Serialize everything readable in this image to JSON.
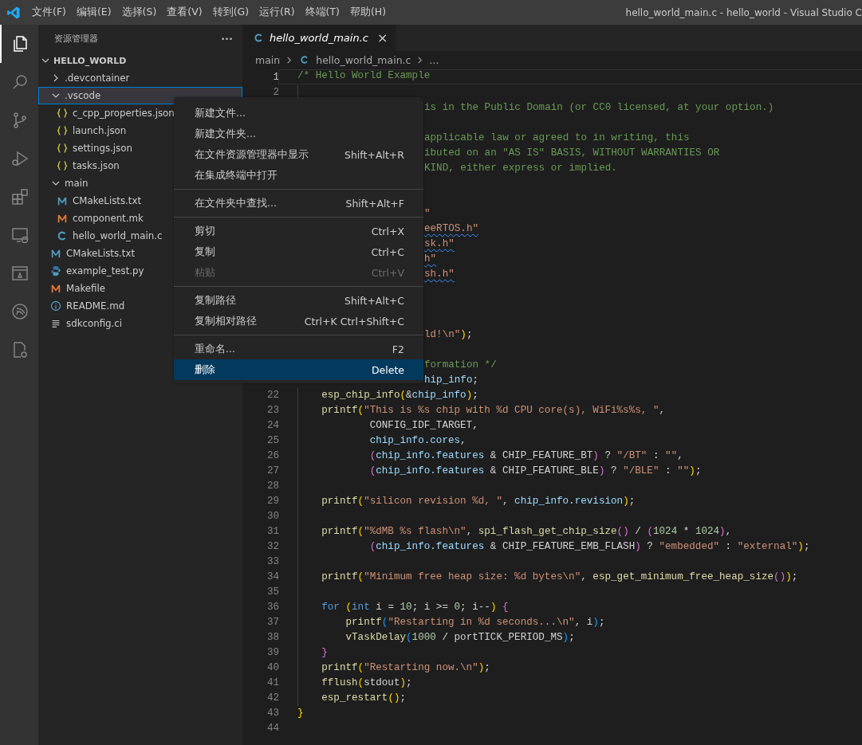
{
  "title_bar": {
    "menus": [
      "文件(F)",
      "编辑(E)",
      "选择(S)",
      "查看(V)",
      "转到(G)",
      "运行(R)",
      "终端(T)",
      "帮助(H)"
    ],
    "title": "hello_world_main.c - hello_world - Visual Studio C"
  },
  "activity_bar": [
    {
      "kind": "files",
      "selected": true
    },
    {
      "kind": "search",
      "selected": false
    },
    {
      "kind": "branch",
      "selected": false
    },
    {
      "kind": "debug",
      "selected": false
    },
    {
      "kind": "extensions",
      "selected": false
    },
    {
      "kind": "remote",
      "selected": false
    },
    {
      "kind": "panel",
      "selected": false
    },
    {
      "kind": "signal",
      "selected": false
    },
    {
      "kind": "doc-gear",
      "selected": false
    }
  ],
  "sidebar": {
    "title": "资源管理器",
    "more": "···",
    "root": {
      "label": "HELLO_WORLD",
      "expanded": true,
      "children": [
        {
          "label": ".devcontainer",
          "kind": "folder",
          "expanded": false,
          "selected": false
        },
        {
          "label": ".vscode",
          "kind": "folder",
          "expanded": true,
          "selected": true,
          "children": [
            {
              "label": "c_cpp_properties.json",
              "kind": "json",
              "selected": false
            },
            {
              "label": "launch.json",
              "kind": "json",
              "selected": false
            },
            {
              "label": "settings.json",
              "kind": "json",
              "selected": false
            },
            {
              "label": "tasks.json",
              "kind": "json",
              "selected": false
            }
          ]
        },
        {
          "label": "main",
          "kind": "folder",
          "expanded": true,
          "selected": false,
          "children": [
            {
              "label": "CMakeLists.txt",
              "kind": "cmake",
              "selected": false
            },
            {
              "label": "component.mk",
              "kind": "make",
              "selected": false
            },
            {
              "label": "hello_world_main.c",
              "kind": "c",
              "selected": false
            }
          ]
        },
        {
          "label": "CMakeLists.txt",
          "kind": "cmake",
          "selected": false
        },
        {
          "label": "example_test.py",
          "kind": "python",
          "selected": false
        },
        {
          "label": "Makefile",
          "kind": "make",
          "selected": false
        },
        {
          "label": "README.md",
          "kind": "info",
          "selected": false
        },
        {
          "label": "sdkconfig.ci",
          "kind": "text",
          "selected": false
        }
      ]
    }
  },
  "tabs": [
    {
      "label": "hello_world_main.c",
      "close": "×",
      "selected": true
    }
  ],
  "breadcrumb": [
    "main",
    "hello_world_main.c",
    "..."
  ],
  "editor": {
    "lines": [
      {
        "number": "1",
        "current": true,
        "covered": false,
        "tokens": [
          {
            "text": "/* Hello World Example",
            "kind": "comment"
          }
        ]
      },
      {
        "number": "2",
        "current": false,
        "covered": false
      },
      {
        "covered": true,
        "tokens": [
          {
            "text": "is in the Public Domain (or CC0 licensed, at your option.)",
            "kind": "comment"
          }
        ]
      },
      {
        "covered": true,
        "tokens": [
          {
            "text": "\napplicable law or agreed to in writing, this",
            "kind": "comment"
          }
        ]
      },
      {
        "covered": true,
        "tokens": [
          {
            "text": "ibuted on an \"AS IS\" BASIS, WITHOUT WARRANTIES OR",
            "kind": "comment"
          }
        ]
      },
      {
        "covered": true,
        "tokens": [
          {
            "text": "KIND, either express or implied.",
            "kind": "comment"
          }
        ]
      },
      {
        "covered": true,
        "tokens": [
          {
            "text": "\n\n\"",
            "kind": "string"
          }
        ]
      },
      {
        "covered": true,
        "tokens": [
          {
            "text": "eeRTOS.h\"",
            "kind": "string",
            "squiggle": true
          }
        ]
      },
      {
        "covered": true,
        "tokens": [
          {
            "text": "sk.h\"",
            "kind": "string",
            "squiggle": true
          }
        ]
      },
      {
        "covered": true,
        "tokens": [
          {
            "text": "h\"",
            "kind": "string",
            "squiggle": true
          }
        ]
      },
      {
        "covered": true,
        "tokens": [
          {
            "text": "sh.h\"",
            "kind": "string",
            "squiggle": true
          }
        ]
      },
      {
        "covered": true,
        "tokens": [
          {
            "text": "\n\n\nld!\\n\"",
            "kind": "string"
          },
          {
            "text": ")",
            "kind": "bracket1"
          },
          {
            "text": ";",
            "kind": "plain"
          }
        ]
      },
      {
        "covered": true,
        "tokens": [
          {
            "text": "\nformation */",
            "kind": "comment"
          }
        ]
      },
      {
        "covered": true,
        "tokens": [
          {
            "text": "hip_info",
            "kind": "var"
          },
          {
            "text": ";",
            "kind": "plain"
          }
        ]
      },
      {
        "number": "22",
        "current": false,
        "covered": false,
        "tokens": [
          {
            "text": "    esp_chip_info",
            "kind": "func"
          },
          {
            "text": "(",
            "kind": "bracket1"
          },
          {
            "text": "&",
            "kind": "plain"
          },
          {
            "text": "chip_info",
            "kind": "var"
          },
          {
            "text": ")",
            "kind": "bracket1"
          },
          {
            "text": ";",
            "kind": "plain"
          }
        ]
      },
      {
        "number": "23",
        "current": false,
        "covered": false,
        "tokens": [
          {
            "text": "    printf",
            "kind": "func"
          },
          {
            "text": "(",
            "kind": "bracket1"
          },
          {
            "text": "\"This is %s chip with %d CPU core(s), WiFi%s%s, \"",
            "kind": "string"
          },
          {
            "text": ",",
            "kind": "plain"
          }
        ]
      },
      {
        "number": "24",
        "current": false,
        "covered": false,
        "tokens": [
          {
            "text": "            CONFIG_IDF_TARGET,",
            "kind": "plain"
          }
        ]
      },
      {
        "number": "25",
        "current": false,
        "covered": false,
        "tokens": [
          {
            "text": "            chip_info.cores",
            "kind": "var"
          },
          {
            "text": ",",
            "kind": "plain"
          }
        ]
      },
      {
        "number": "26",
        "current": false,
        "covered": false,
        "tokens": [
          {
            "text": "            (",
            "kind": "bracket2"
          },
          {
            "text": "chip_info.features",
            "kind": "var"
          },
          {
            "text": " & CHIP_FEATURE_BT",
            "kind": "plain"
          },
          {
            "text": ")",
            "kind": "bracket2"
          },
          {
            "text": " ? ",
            "kind": "plain"
          },
          {
            "text": "\"/BT\"",
            "kind": "string"
          },
          {
            "text": " : ",
            "kind": "plain"
          },
          {
            "text": "\"\"",
            "kind": "string"
          },
          {
            "text": ",",
            "kind": "plain"
          }
        ]
      },
      {
        "number": "27",
        "current": false,
        "covered": false,
        "tokens": [
          {
            "text": "            (",
            "kind": "bracket2"
          },
          {
            "text": "chip_info.features",
            "kind": "var"
          },
          {
            "text": " & CHIP_FEATURE_BLE",
            "kind": "plain"
          },
          {
            "text": ")",
            "kind": "bracket2"
          },
          {
            "text": " ? ",
            "kind": "plain"
          },
          {
            "text": "\"/BLE\"",
            "kind": "string"
          },
          {
            "text": " : ",
            "kind": "plain"
          },
          {
            "text": "\"\"",
            "kind": "string"
          },
          {
            "text": ")",
            "kind": "bracket1"
          },
          {
            "text": ";",
            "kind": "plain"
          }
        ]
      },
      {
        "number": "28",
        "current": false,
        "covered": false
      },
      {
        "number": "29",
        "current": false,
        "covered": false,
        "tokens": [
          {
            "text": "    printf",
            "kind": "func"
          },
          {
            "text": "(",
            "kind": "bracket1"
          },
          {
            "text": "\"silicon revision %d, \"",
            "kind": "string"
          },
          {
            "text": ", ",
            "kind": "plain"
          },
          {
            "text": "chip_info.revision",
            "kind": "var"
          },
          {
            "text": ")",
            "kind": "bracket1"
          },
          {
            "text": ";",
            "kind": "plain"
          }
        ]
      },
      {
        "number": "30",
        "current": false,
        "covered": false
      },
      {
        "number": "31",
        "current": false,
        "covered": false,
        "tokens": [
          {
            "text": "    printf",
            "kind": "func"
          },
          {
            "text": "(",
            "kind": "bracket1"
          },
          {
            "text": "\"%dMB %s flash\\n\"",
            "kind": "string"
          },
          {
            "text": ", ",
            "kind": "plain"
          },
          {
            "text": "spi_flash_get_chip_size",
            "kind": "func"
          },
          {
            "text": "()",
            "kind": "bracket2"
          },
          {
            "text": " / ",
            "kind": "plain"
          },
          {
            "text": "(",
            "kind": "bracket2"
          },
          {
            "text": "1024",
            "kind": "number"
          },
          {
            "text": " * ",
            "kind": "plain"
          },
          {
            "text": "1024",
            "kind": "number"
          },
          {
            "text": ")",
            "kind": "bracket2"
          },
          {
            "text": ",",
            "kind": "plain"
          }
        ]
      },
      {
        "number": "32",
        "current": false,
        "covered": false,
        "tokens": [
          {
            "text": "            (",
            "kind": "bracket2"
          },
          {
            "text": "chip_info.features",
            "kind": "var"
          },
          {
            "text": " & CHIP_FEATURE_EMB_FLASH",
            "kind": "plain"
          },
          {
            "text": ")",
            "kind": "bracket2"
          },
          {
            "text": " ? ",
            "kind": "plain"
          },
          {
            "text": "\"embedded\"",
            "kind": "string"
          },
          {
            "text": " : ",
            "kind": "plain"
          },
          {
            "text": "\"external\"",
            "kind": "string"
          },
          {
            "text": ")",
            "kind": "bracket1"
          },
          {
            "text": ";",
            "kind": "plain"
          }
        ]
      },
      {
        "number": "33",
        "current": false,
        "covered": false
      },
      {
        "number": "34",
        "current": false,
        "covered": false,
        "tokens": [
          {
            "text": "    printf",
            "kind": "func"
          },
          {
            "text": "(",
            "kind": "bracket1"
          },
          {
            "text": "\"Minimum free heap size: %d bytes\\n\"",
            "kind": "string"
          },
          {
            "text": ", ",
            "kind": "plain"
          },
          {
            "text": "esp_get_minimum_free_heap_size",
            "kind": "func"
          },
          {
            "text": "()",
            "kind": "bracket2"
          },
          {
            "text": ")",
            "kind": "bracket1"
          },
          {
            "text": ";",
            "kind": "plain"
          }
        ]
      },
      {
        "number": "35",
        "current": false,
        "covered": false
      },
      {
        "number": "36",
        "current": false,
        "covered": false,
        "tokens": [
          {
            "text": "    for",
            "kind": "keyword"
          },
          {
            "text": " (",
            "kind": "bracket1"
          },
          {
            "text": "int",
            "kind": "keyword"
          },
          {
            "text": " i = ",
            "kind": "plain"
          },
          {
            "text": "10",
            "kind": "number"
          },
          {
            "text": "; i >= ",
            "kind": "plain"
          },
          {
            "text": "0",
            "kind": "number"
          },
          {
            "text": "; i--",
            "kind": "plain"
          },
          {
            "text": ")",
            "kind": "bracket1"
          },
          {
            "text": " {",
            "kind": "bracket2"
          }
        ]
      },
      {
        "number": "37",
        "current": false,
        "covered": false,
        "tokens": [
          {
            "text": "        printf",
            "kind": "func"
          },
          {
            "text": "(",
            "kind": "bracket3"
          },
          {
            "text": "\"Restarting in %d seconds...\\n\"",
            "kind": "string"
          },
          {
            "text": ", i",
            "kind": "plain"
          },
          {
            "text": ")",
            "kind": "bracket3"
          },
          {
            "text": ";",
            "kind": "plain"
          }
        ]
      },
      {
        "number": "38",
        "current": false,
        "covered": false,
        "tokens": [
          {
            "text": "        vTaskDelay",
            "kind": "func"
          },
          {
            "text": "(",
            "kind": "bracket3"
          },
          {
            "text": "1000",
            "kind": "number"
          },
          {
            "text": " / portTICK_PERIOD_MS",
            "kind": "plain"
          },
          {
            "text": ")",
            "kind": "bracket3"
          },
          {
            "text": ";",
            "kind": "plain"
          }
        ]
      },
      {
        "number": "39",
        "current": false,
        "covered": false,
        "tokens": [
          {
            "text": "    }",
            "kind": "bracket2"
          }
        ]
      },
      {
        "number": "40",
        "current": false,
        "covered": false,
        "tokens": [
          {
            "text": "    printf",
            "kind": "func"
          },
          {
            "text": "(",
            "kind": "bracket1"
          },
          {
            "text": "\"Restarting now.\\n\"",
            "kind": "string"
          },
          {
            "text": ")",
            "kind": "bracket1"
          },
          {
            "text": ";",
            "kind": "plain"
          }
        ]
      },
      {
        "number": "41",
        "current": false,
        "covered": false,
        "tokens": [
          {
            "text": "    fflush",
            "kind": "func"
          },
          {
            "text": "(",
            "kind": "bracket1"
          },
          {
            "text": "stdout",
            "kind": "plain"
          },
          {
            "text": ")",
            "kind": "bracket1"
          },
          {
            "text": ";",
            "kind": "plain"
          }
        ]
      },
      {
        "number": "42",
        "current": false,
        "covered": false,
        "tokens": [
          {
            "text": "    esp_restart",
            "kind": "func"
          },
          {
            "text": "()",
            "kind": "bracket1"
          },
          {
            "text": ";",
            "kind": "plain"
          }
        ]
      },
      {
        "number": "43",
        "current": false,
        "covered": false,
        "tokens": [
          {
            "text": "}",
            "kind": "bracket1"
          }
        ]
      },
      {
        "number": "44",
        "current": false,
        "covered": false
      }
    ]
  },
  "context_menu": {
    "groups": [
      [
        {
          "label": "新建文件...",
          "disabled": false,
          "selected": false
        },
        {
          "label": "新建文件夹...",
          "disabled": false,
          "selected": false
        },
        {
          "label": "在文件资源管理器中显示",
          "shortcut": "Shift+Alt+R",
          "disabled": false,
          "selected": false
        },
        {
          "label": "在集成终端中打开",
          "disabled": false,
          "selected": false
        }
      ],
      [
        {
          "label": "在文件夹中查找...",
          "shortcut": "Shift+Alt+F",
          "disabled": false,
          "selected": false
        }
      ],
      [
        {
          "label": "剪切",
          "shortcut": "Ctrl+X",
          "disabled": false,
          "selected": false
        },
        {
          "label": "复制",
          "shortcut": "Ctrl+C",
          "disabled": false,
          "selected": false
        },
        {
          "label": "粘贴",
          "shortcut": "Ctrl+V",
          "disabled": true,
          "selected": false
        }
      ],
      [
        {
          "label": "复制路径",
          "shortcut": "Shift+Alt+C",
          "disabled": false,
          "selected": false
        },
        {
          "label": "复制相对路径",
          "shortcut": "Ctrl+K Ctrl+Shift+C",
          "disabled": false,
          "selected": false
        }
      ],
      [
        {
          "label": "重命名...",
          "shortcut": "F2",
          "disabled": false,
          "selected": false
        },
        {
          "label": "删除",
          "shortcut": "Delete",
          "disabled": false,
          "selected": true
        }
      ]
    ]
  }
}
